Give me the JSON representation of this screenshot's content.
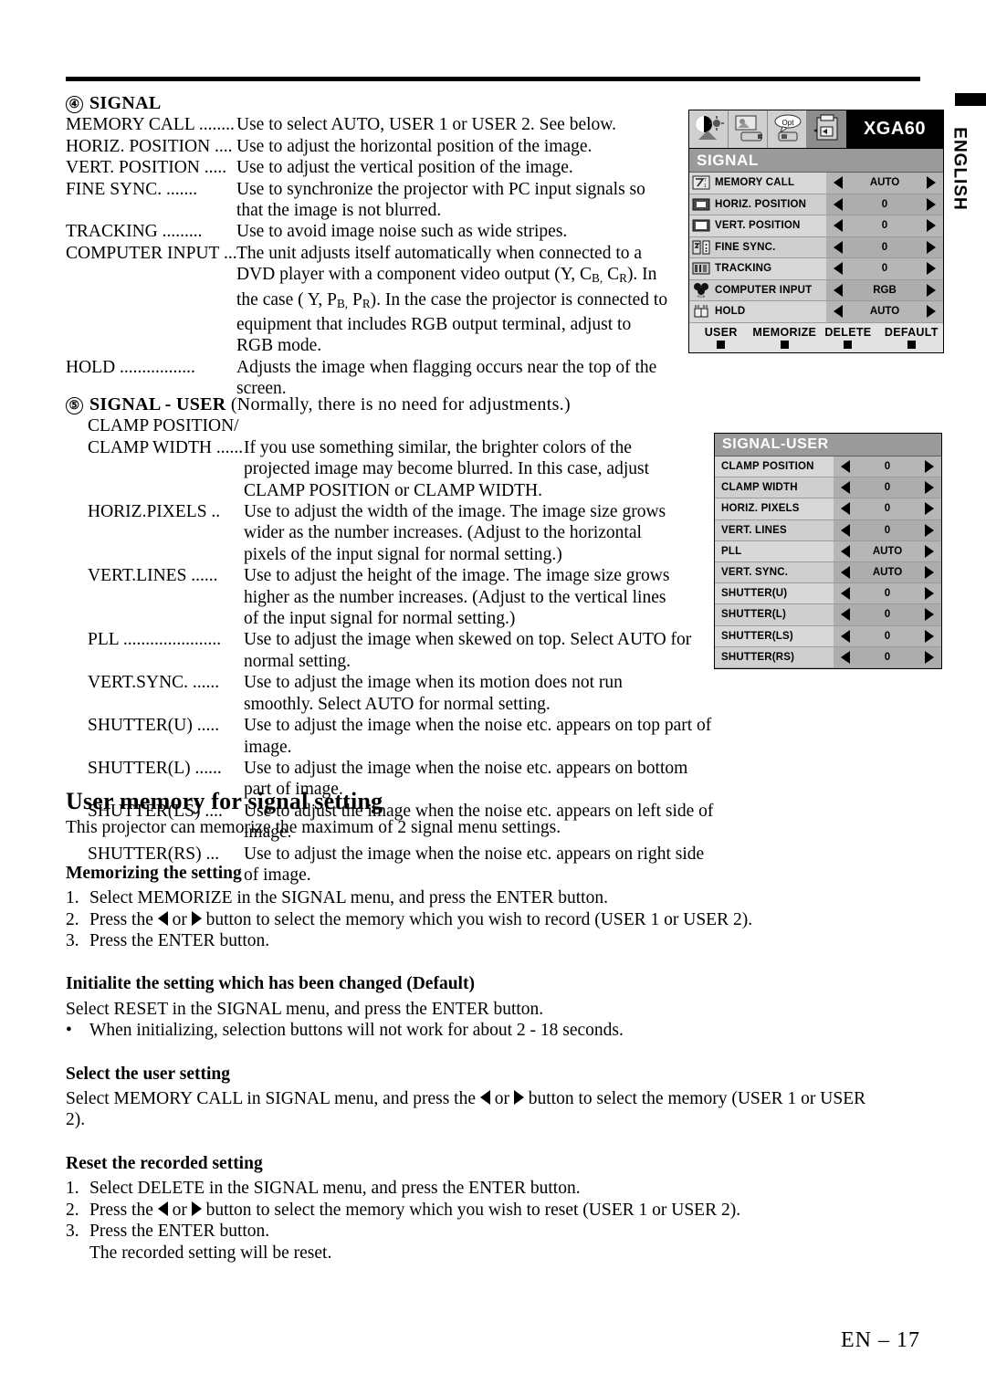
{
  "page": {
    "footer": "EN – 17",
    "side_tab": "ENGLISH"
  },
  "section4": {
    "number": "④",
    "heading": "SIGNAL",
    "items": [
      {
        "label": "MEMORY CALL ........",
        "body": "Use to select AUTO, USER 1 or USER 2. See below."
      },
      {
        "label": "HORIZ. POSITION ....",
        "body": "Use to adjust the horizontal position of the image."
      },
      {
        "label": "VERT. POSITION .....",
        "body": "Use to adjust the vertical position of the image."
      },
      {
        "label": "FINE SYNC. .......",
        "body": "Use to synchronize the projector with PC input signals so",
        "cont": [
          "that the image is not blurred."
        ]
      },
      {
        "label": "TRACKING .........",
        "body": "Use to avoid image noise such as wide stripes."
      },
      {
        "label": "COMPUTER INPUT ....",
        "body": "The unit adjusts itself automatically when connected to a",
        "cont_html": [
          "DVD player with a component video output (Y, C<sub>B,</sub> C<sub>R</sub>). In",
          "the case ( Y, P<sub>B,</sub> P<sub>R</sub>). In the case the projector is connected to",
          "equipment that includes RGB output terminal, adjust to",
          "RGB mode."
        ]
      },
      {
        "label": "HOLD .................",
        "body": "Adjusts the image when flagging occurs near the top of the",
        "cont": [
          "screen."
        ]
      }
    ]
  },
  "section5": {
    "number": "⑤",
    "heading_bold": "SIGNAL  - USER",
    "heading_rest": "(Normally, there is no need for adjustments.)",
    "subline": "CLAMP POSITION/",
    "items": [
      {
        "label": "CLAMP WIDTH .........",
        "body": "If you use something similar, the brighter colors of the",
        "cont": [
          "projected image may become blurred. In this case, adjust",
          "CLAMP POSITION or CLAMP WIDTH."
        ]
      },
      {
        "label": "HORIZ.PIXELS ..",
        "body": "Use to adjust the width of the image.  The image size grows",
        "cont": [
          "wider as the number increases.  (Adjust to the horizontal",
          "pixels of the input signal for normal setting.)"
        ]
      },
      {
        "label": "VERT.LINES ......",
        "body": "Use to adjust the height of the image.  The image size grows",
        "cont": [
          "higher as the number increases.  (Adjust to the vertical lines",
          "of the input signal for normal setting.)"
        ]
      },
      {
        "label": "PLL ......................",
        "body": "Use to adjust the image when skewed on top.  Select AUTO for",
        "cont": [
          "normal setting."
        ]
      },
      {
        "label": "VERT.SYNC. ......",
        "body": "Use to adjust the image when its motion does not run",
        "cont": [
          "smoothly.  Select AUTO for normal setting."
        ]
      },
      {
        "label": "SHUTTER(U) .....",
        "body": "Use to adjust the image when the noise etc. appears on top part of image."
      },
      {
        "label": "SHUTTER(L) ......",
        "body": "Use to adjust the image when the noise etc. appears on bottom part of image."
      },
      {
        "label": "SHUTTER(LS) ....",
        "body": "Use to adjust the image when the noise etc. appears on left side of image."
      },
      {
        "label": "SHUTTER(RS) ...",
        "body": "Use to adjust the image when the noise etc. appears on right side of image."
      }
    ]
  },
  "user_memory": {
    "title": "User memory for signal setting",
    "intro": "This projector can memorize the maximum of 2 signal menu settings.",
    "memorizing": {
      "title": "Memorizing the setting",
      "steps": [
        {
          "n": "1.",
          "text": "Select MEMORIZE in the SIGNAL menu, and press the ENTER button."
        },
        {
          "n": "2.",
          "pre": "Press the",
          "mid": "or",
          "post": "button to select the memory which you wish to record (USER 1 or USER 2)."
        },
        {
          "n": "3.",
          "text": "Press the ENTER button."
        }
      ]
    },
    "initialize": {
      "title": "Initialite the setting which has been changed (Default)",
      "line": "Select RESET in the SIGNAL menu, and press the ENTER button.",
      "bullet": "When initializing, selection buttons will not work for about 2 - 18 seconds."
    },
    "select_user": {
      "title": "Select the user setting",
      "pre": "Select MEMORY CALL in SIGNAL menu, and press the",
      "mid": "or",
      "post": "button to select the memory (USER 1 or USER 2)."
    },
    "reset": {
      "title": "Reset the recorded setting",
      "steps": [
        {
          "n": "1.",
          "text": "Select DELETE in the SIGNAL menu, and press the ENTER button."
        },
        {
          "n": "2.",
          "pre": "Press the",
          "mid": "or",
          "post": "button to select the memory which you wish to reset (USER 1 or USER 2)."
        },
        {
          "n": "3.",
          "text": "Press the ENTER button."
        }
      ],
      "tail": "The recorded setting will be reset."
    }
  },
  "signal_menu": {
    "preset": "XGA60",
    "title": "SIGNAL",
    "tabs": [
      {
        "icon": "contrast-brightness-icon",
        "selected": false
      },
      {
        "icon": "image-projector-icon",
        "selected": false
      },
      {
        "icon": "option-opt-icon",
        "selected": false
      },
      {
        "icon": "signal-icon",
        "selected": true
      }
    ],
    "rows": [
      {
        "icon": "memory-call-icon",
        "label": "MEMORY CALL",
        "value": "AUTO"
      },
      {
        "icon": "horiz-position-icon",
        "label": "HORIZ. POSITION",
        "value": "0"
      },
      {
        "icon": "vert-position-icon",
        "label": "VERT. POSITION",
        "value": "0"
      },
      {
        "icon": "fine-sync-icon",
        "label": "FINE SYNC.",
        "value": "0"
      },
      {
        "icon": "tracking-icon",
        "label": "TRACKING",
        "value": "0"
      },
      {
        "icon": "computer-input-rgb-icon",
        "label": "COMPUTER INPUT",
        "value": "RGB"
      },
      {
        "icon": "hold-icon",
        "label": "HOLD",
        "value": "AUTO"
      }
    ],
    "footer_buttons": [
      "USER",
      "MEMORIZE",
      "DELETE",
      "DEFAULT"
    ]
  },
  "signal_user_menu": {
    "title": "SIGNAL-USER",
    "rows": [
      {
        "label": "CLAMP POSITION",
        "value": "0"
      },
      {
        "label": "CLAMP WIDTH",
        "value": "0"
      },
      {
        "label": "HORIZ. PIXELS",
        "value": "0"
      },
      {
        "label": "VERT. LINES",
        "value": "0"
      },
      {
        "label": "PLL",
        "value": "AUTO"
      },
      {
        "label": "VERT. SYNC.",
        "value": "AUTO"
      },
      {
        "label": "SHUTTER(U)",
        "value": "0"
      },
      {
        "label": "SHUTTER(L)",
        "value": "0"
      },
      {
        "label": "SHUTTER(LS)",
        "value": "0"
      },
      {
        "label": "SHUTTER(RS)",
        "value": "0"
      }
    ]
  },
  "colors": {
    "menu_bg": "#d6d6d6",
    "menu_bar": "#9a9a9a",
    "value_bg": "#b6b6b6",
    "title_bg": "#000000",
    "text": "#000000"
  }
}
